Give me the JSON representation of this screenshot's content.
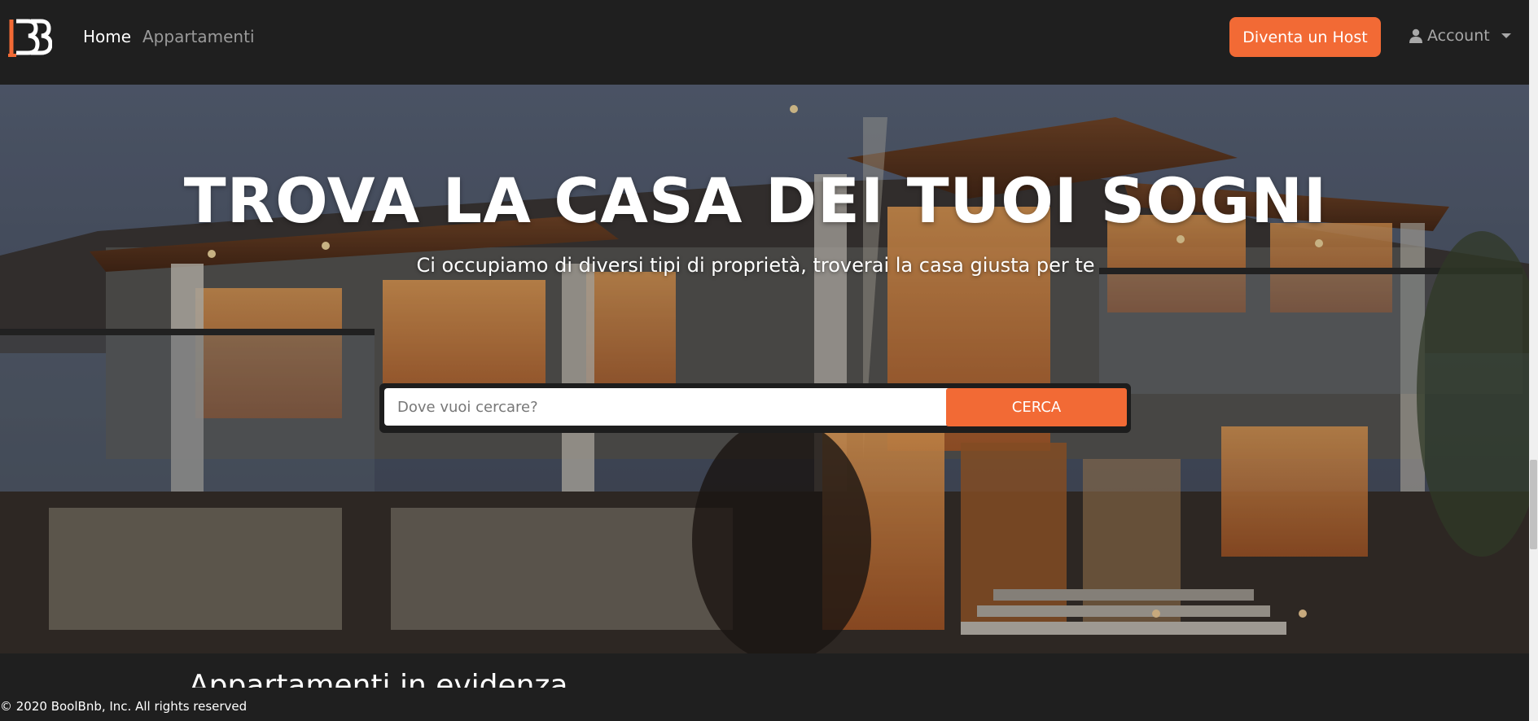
{
  "navbar": {
    "logo_alt": "BoolBnb",
    "links": [
      {
        "label": "Home"
      },
      {
        "label": "Appartamenti"
      }
    ],
    "host_button": "Diventa un Host",
    "account_label": "Account",
    "account_icon": "user-icon"
  },
  "hero": {
    "title": "TROVA LA CASA DEI TUOI SOGNI",
    "subtitle": "Ci occupiamo di diversi tipi di proprietà, troverai la casa giusta per te",
    "search": {
      "placeholder": "Dove vuoi cercare?",
      "value": "",
      "button": "CERCA"
    }
  },
  "featured": {
    "title": "Appartamenti in evidenza"
  },
  "footer": {
    "text": "© 2020 BoolBnb, Inc. All rights reserved"
  },
  "colors": {
    "accent": "#f26a35",
    "navbar_bg": "#1f1f1f"
  }
}
